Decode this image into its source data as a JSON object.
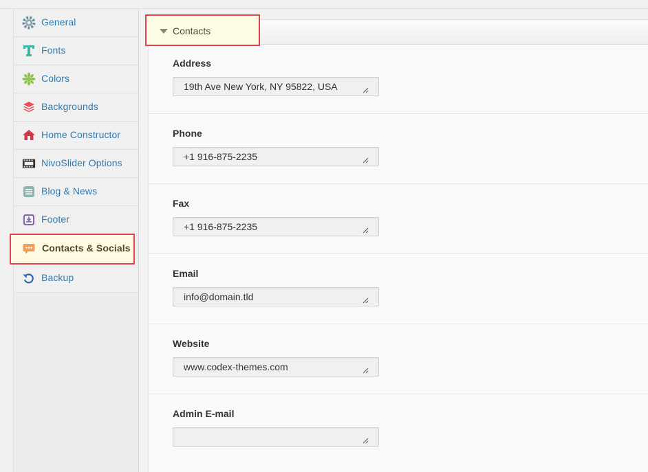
{
  "sidebar": {
    "items": [
      {
        "label": "General",
        "icon": "gear-icon",
        "color": "#6f8f9e"
      },
      {
        "label": "Fonts",
        "icon": "font-icon",
        "color": "#3cb7a8"
      },
      {
        "label": "Colors",
        "icon": "palette-icon",
        "color": "#8ac24a"
      },
      {
        "label": "Backgrounds",
        "icon": "layers-icon",
        "color": "#e8505b"
      },
      {
        "label": "Home Constructor",
        "icon": "home-icon",
        "color": "#cc3b47"
      },
      {
        "label": "NivoSlider Options",
        "icon": "film-icon",
        "color": "#333333"
      },
      {
        "label": "Blog & News",
        "icon": "list-icon",
        "color": "#8fb4b0"
      },
      {
        "label": "Footer",
        "icon": "download-box-icon",
        "color": "#7d6aa6"
      },
      {
        "label": "Contacts & Socials",
        "icon": "speech-bubble-icon",
        "color": "#f0a05a",
        "active": true
      },
      {
        "label": "Backup",
        "icon": "refresh-icon",
        "color": "#2e6aa8"
      }
    ]
  },
  "section": {
    "title": "Contacts"
  },
  "fields": [
    {
      "label": "Address",
      "value": "19th Ave New York, NY 95822, USA"
    },
    {
      "label": "Phone",
      "value": "+1 916-875-2235"
    },
    {
      "label": "Fax",
      "value": "+1 916-875-2235"
    },
    {
      "label": "Email",
      "value": "info@domain.tld"
    },
    {
      "label": "Website",
      "value": "www.codex-themes.com"
    },
    {
      "label": "Admin E-mail",
      "value": ""
    }
  ],
  "colors": {
    "highlight_border": "#e0434f",
    "active_bg": "#fefbe2",
    "link": "#2e7bb0"
  }
}
